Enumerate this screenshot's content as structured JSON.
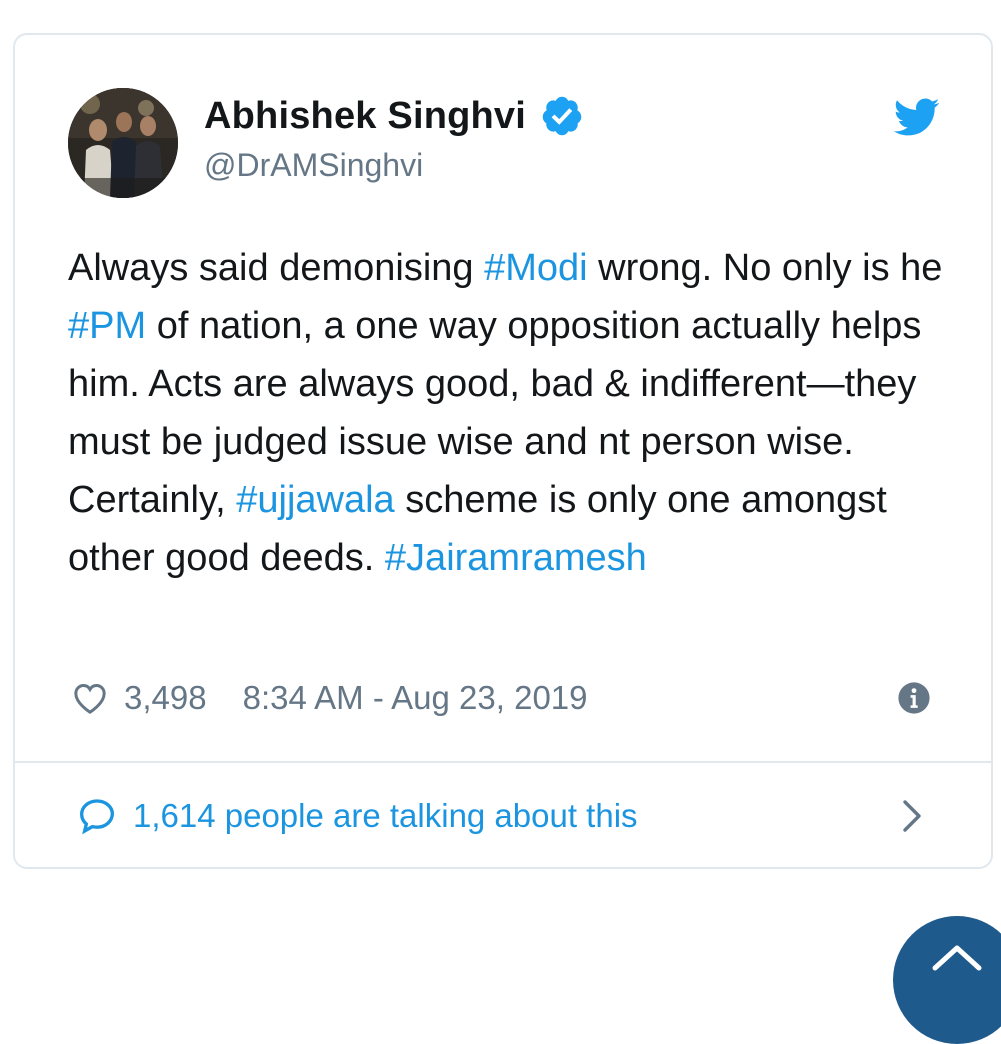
{
  "tweet": {
    "author": {
      "name": "Abhishek Singhvi",
      "handle": "@DrAMSinghvi",
      "verified": true
    },
    "text_segments": [
      {
        "text": "Always said demonising ",
        "type": "text"
      },
      {
        "text": "#Modi",
        "type": "hashtag"
      },
      {
        "text": " wrong. No only is he ",
        "type": "text"
      },
      {
        "text": "#PM",
        "type": "hashtag"
      },
      {
        "text": " of nation, a one way opposition actually helps him. Acts are always good, bad & indifferent—they must be judged issue wise and nt person wise. Certainly, ",
        "type": "text"
      },
      {
        "text": "#ujjawala",
        "type": "hashtag"
      },
      {
        "text": " scheme is only one amongst other good deeds. ",
        "type": "text"
      },
      {
        "text": "#Jairamramesh",
        "type": "hashtag"
      }
    ],
    "likes": "3,498",
    "timestamp": "8:34 AM - Aug 23, 2019",
    "talking": "1,614 people are talking about this"
  },
  "icons": {
    "verified": "verified-badge-icon",
    "brand": "twitter-bird-icon",
    "like": "heart-icon",
    "info": "info-icon",
    "reply": "speech-bubble-icon",
    "chevron": "chevron-right-icon",
    "scroll_top": "chevron-up-icon"
  },
  "colors": {
    "accent": "#1da1f2",
    "hashtag": "#1b95e0",
    "text": "#14171a",
    "muted": "#657786",
    "border": "#e1e8ed",
    "fab": "#1f5a8c"
  }
}
